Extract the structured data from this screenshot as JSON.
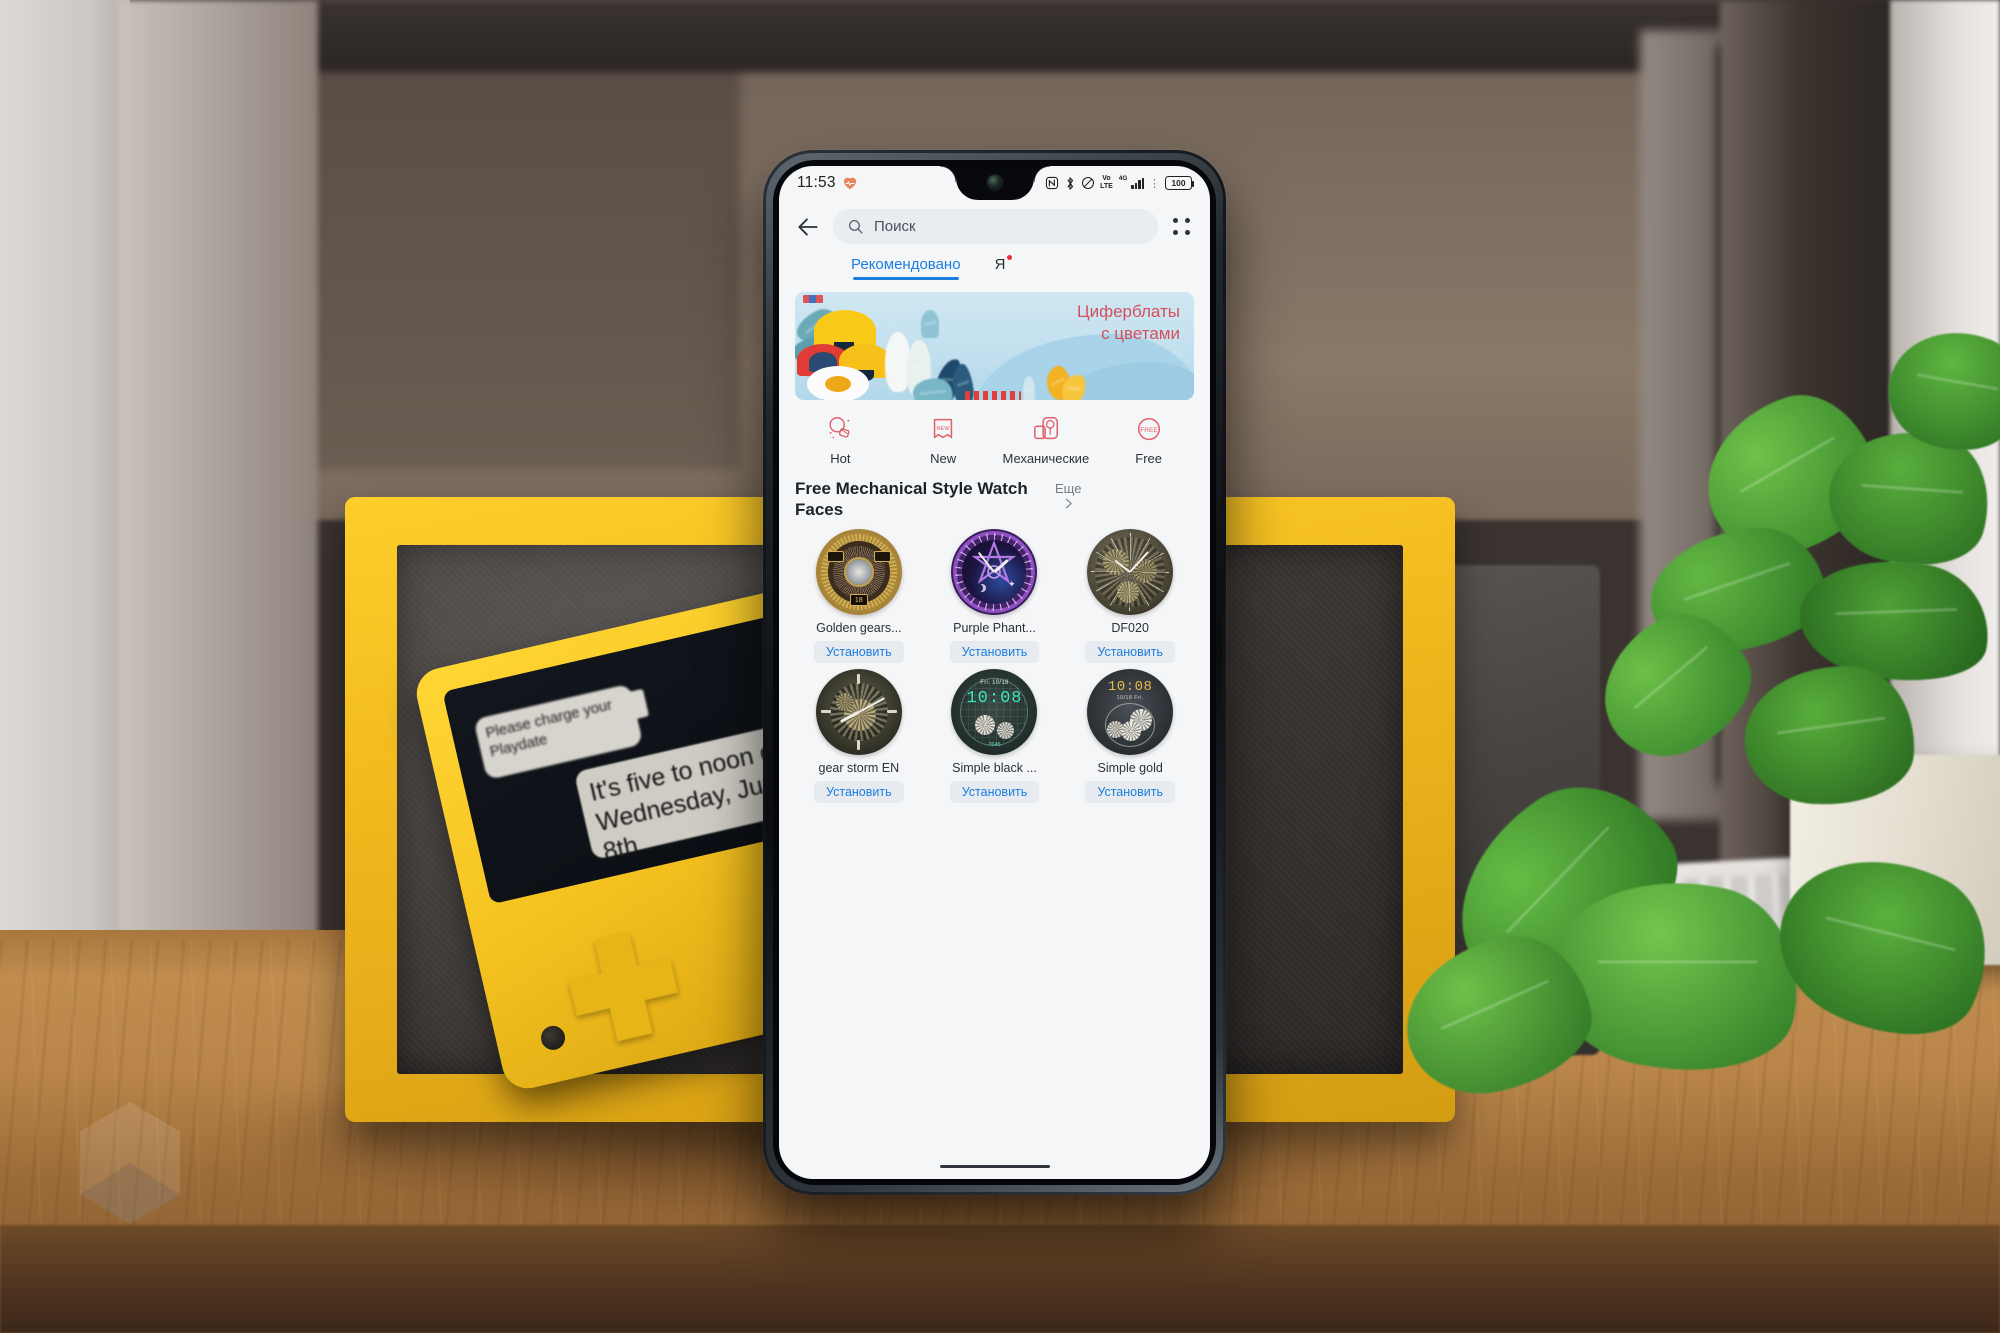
{
  "scene": {
    "description": "Smartphone standing on a wooden shelf in front of a yellow framed Playdate console, with a potted plant on the right",
    "playdate_screen": {
      "bubble_charge": "Please charge your Playdate",
      "bubble_time": "It's five to noon on Wednesday, June 8th"
    }
  },
  "phone": {
    "status_bar": {
      "time": "11:53",
      "heart_icon": "heart-rate-icon",
      "icons": [
        "nfc-icon",
        "bluetooth-icon",
        "silent-mode-icon"
      ],
      "volte_top": "Vo",
      "volte_bottom": "LTE",
      "network_type": "4G",
      "signal_bars": 4,
      "battery_level": "100"
    },
    "app_bar": {
      "back_icon": "back-arrow-icon",
      "search_icon": "search-icon",
      "search_placeholder": "Поиск",
      "search_value": "",
      "grid_icon": "apps-grid-icon"
    },
    "tabs": [
      {
        "label": "Рекомендовано",
        "active": true,
        "badge": false
      },
      {
        "label": "Я",
        "active": false,
        "badge": true
      }
    ],
    "banner": {
      "title_line1": "Циферблаты",
      "title_line2": "с цветами",
      "text_color": "#d4505e",
      "background_color": "#c3e0ef"
    },
    "categories": [
      {
        "label": "Hot",
        "icon": "hot-fire-icon"
      },
      {
        "label": "New",
        "icon": "new-ribbon-icon"
      },
      {
        "label": "Механические",
        "icon": "mechanical-watch-icon"
      },
      {
        "label": "Free",
        "icon": "free-badge-icon"
      }
    ],
    "section": {
      "title": "Free Mechanical Style Watch Faces",
      "more_label": "Еще",
      "more_icon": "chevron-right-icon"
    },
    "watch_faces": [
      {
        "name": "Golden gears...",
        "install_label": "Установить",
        "style": "golden"
      },
      {
        "name": "Purple Phant...",
        "install_label": "Установить",
        "style": "purple"
      },
      {
        "name": "DF020",
        "install_label": "Установить",
        "style": "df020"
      },
      {
        "name": "gear storm EN",
        "install_label": "Установить",
        "style": "gearstorm"
      },
      {
        "name": "Simple black ...",
        "install_label": "Установить",
        "style": "simpleblack"
      },
      {
        "name": "Simple gold",
        "install_label": "Установить",
        "style": "simplegold"
      }
    ],
    "watch_face_previews": {
      "simple_black_time": "10:08",
      "simple_black_date": "Fri. 10/18",
      "simple_gold_time": "10:08",
      "simple_gold_date": "10/18   Fri."
    },
    "accent_color": "#1b7ee0",
    "home_indicator": "home-indicator"
  }
}
